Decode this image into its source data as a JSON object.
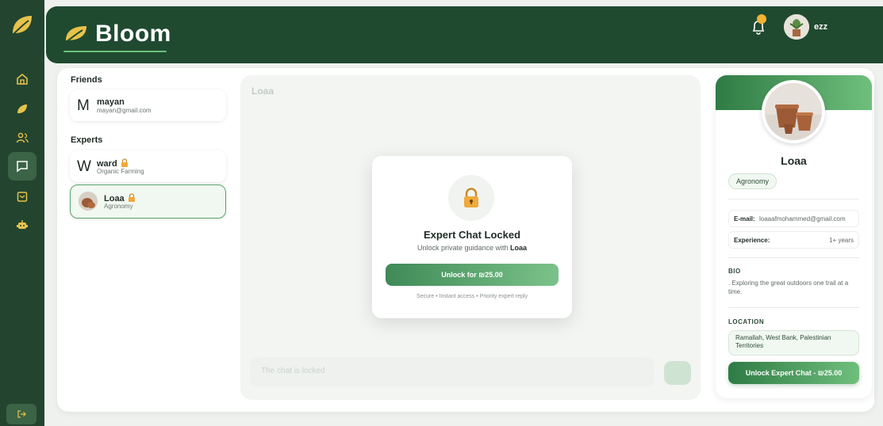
{
  "app": {
    "name": "Bloom"
  },
  "header": {
    "user_name": "ezz",
    "notification_count": 1
  },
  "sidebar": {
    "items": [
      {
        "icon": "home-icon"
      },
      {
        "icon": "leaf-icon"
      },
      {
        "icon": "users-icon"
      },
      {
        "icon": "chat-icon",
        "active": true
      },
      {
        "icon": "clipboard-icon"
      },
      {
        "icon": "robot-icon"
      }
    ],
    "logout_icon": "logout-icon"
  },
  "friends": {
    "title": "Friends",
    "items": [
      {
        "initial": "M",
        "name": "mayan",
        "sub": "mayan@gmail.com"
      }
    ]
  },
  "experts": {
    "title": "Experts",
    "items": [
      {
        "initial": "W",
        "name": "ward",
        "sub": "Organic Farming",
        "locked": true
      },
      {
        "name": "Loaa",
        "sub": "Agronomy",
        "locked": true,
        "selected": true
      }
    ]
  },
  "chat": {
    "title": "Loaa",
    "input_placeholder": "The chat is locked"
  },
  "modal": {
    "title": "Expert Chat Locked",
    "sub_prefix": "Unlock private guidance with ",
    "sub_name": "Loaa",
    "button": "Unlock for ₪25.00",
    "footer": "Secure • Instant access • Priority expert reply"
  },
  "profile": {
    "name": "Loaa",
    "tag": "Agronomy",
    "email_label": "E-mail:",
    "email": "loaaafmohammed@gmail.com",
    "experience_label": "Experience:",
    "experience": "1+ years",
    "bio_label": "BIO",
    "bio": ". Exploring the great outdoors one trail at a time.",
    "location_label": "LOCATION",
    "location": "Ramallah, West Bank, Palestinian Territories",
    "unlock_button": "Unlock Expert Chat - ₪25.00"
  },
  "colors": {
    "sidebar": "#23452f",
    "header": "#1f4a30",
    "accent": "#3f8a57",
    "accent_light": "#7bc28a",
    "badge": "#f2b233"
  }
}
